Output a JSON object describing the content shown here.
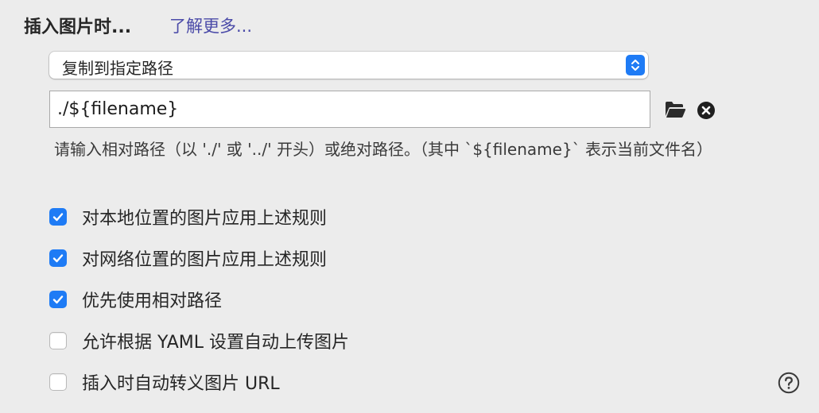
{
  "header": {
    "title": "插入图片时...",
    "learn_more": "了解更多..."
  },
  "select": {
    "value": "复制到指定路径"
  },
  "path_field": {
    "value": "./${filename}"
  },
  "hint": "请输入相对路径（以 './' 或 '../' 开头）或绝对路径。（其中 `${filename}` 表示当前文件名）",
  "options": [
    {
      "label": "对本地位置的图片应用上述规则",
      "checked": true
    },
    {
      "label": "对网络位置的图片应用上述规则",
      "checked": true
    },
    {
      "label": "优先使用相对路径",
      "checked": true
    },
    {
      "label": "允许根据 YAML 设置自动上传图片",
      "checked": false
    },
    {
      "label": "插入时自动转义图片 URL",
      "checked": false
    }
  ],
  "icons": {
    "folder": "folder-icon",
    "clear": "clear-circle-icon",
    "help": "question-circle-icon"
  },
  "colors": {
    "accent": "#1e7bf5",
    "link": "#4a4aa8",
    "background": "#ececec"
  }
}
